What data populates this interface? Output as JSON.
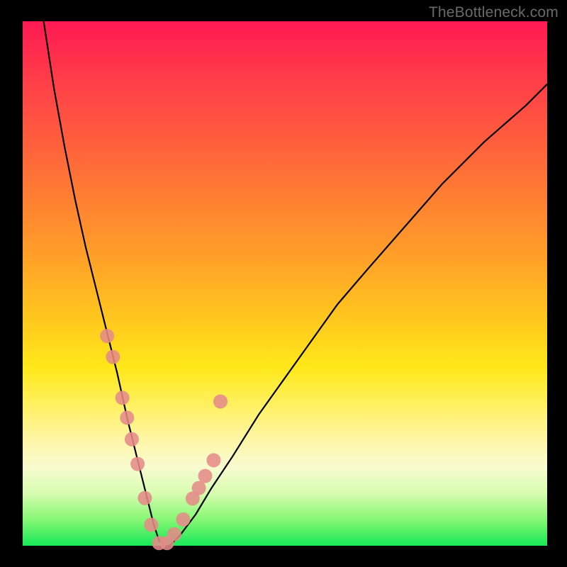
{
  "watermark": "TheBottleneck.com",
  "chart_data": {
    "type": "line",
    "title": "",
    "xlabel": "",
    "ylabel": "",
    "xlim": [
      0,
      100
    ],
    "ylim": [
      0,
      100
    ],
    "series": [
      {
        "name": "bottleneck-curve",
        "x": [
          4,
          6,
          8,
          10,
          12,
          14,
          16,
          18,
          20,
          21,
          22,
          23,
          24,
          25,
          26,
          27,
          28,
          30,
          33,
          36,
          40,
          45,
          50,
          55,
          60,
          66,
          73,
          80,
          88,
          96,
          100
        ],
        "values": [
          100,
          87,
          76,
          66,
          57,
          49,
          41,
          33,
          24,
          20,
          16,
          12,
          8,
          4,
          1,
          0,
          0,
          2,
          6,
          11,
          17,
          25,
          32,
          39,
          46,
          53,
          61,
          69,
          77,
          84,
          88
        ]
      }
    ],
    "markers": {
      "name": "highlighted-points",
      "x": [
        16.1,
        17.2,
        19.0,
        19.9,
        20.8,
        21.9,
        23.3,
        24.5,
        26.0,
        27.5,
        28.9,
        30.6,
        32.4,
        33.6,
        34.8,
        36.4,
        37.7
      ],
      "values": [
        40.0,
        36.0,
        28.2,
        24.4,
        20.3,
        15.6,
        9.1,
        4.0,
        0.5,
        0.5,
        2.2,
        5.0,
        9.0,
        11.0,
        13.3,
        16.3,
        27.5
      ]
    },
    "gradient_background": {
      "direction": "vertical",
      "stops": [
        {
          "pos": 0.0,
          "color": "#ff1a52"
        },
        {
          "pos": 0.33,
          "color": "#ff7d33"
        },
        {
          "pos": 0.66,
          "color": "#ffe81a"
        },
        {
          "pos": 0.9,
          "color": "#d7fcb0"
        },
        {
          "pos": 1.0,
          "color": "#18e858"
        }
      ]
    }
  }
}
